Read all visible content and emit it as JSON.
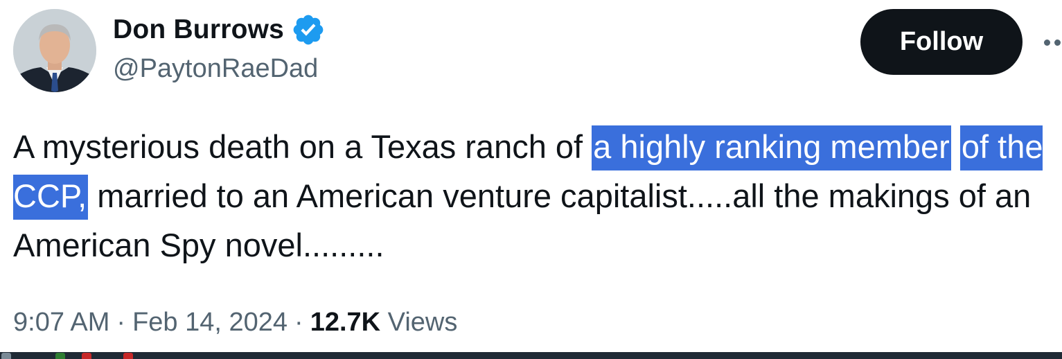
{
  "author": {
    "display_name": "Don Burrows",
    "handle": "@PaytonRaeDad",
    "verified": true,
    "verified_badge_color": "#1d9bf0",
    "avatar_icon": "profile-photo"
  },
  "actions": {
    "follow_label": "Follow",
    "more_icon": "more-horizontal-icon"
  },
  "tweet": {
    "text_before_highlight": "A mysterious death on a Texas ranch of ",
    "text_highlight_line1": "a highly ranking member",
    "text_highlight_line2": "of the CCP,",
    "text_after_highlight": " married to an American venture capitalist.....all the makings of an American Spy novel.........",
    "highlight_color": "#3a6fdc"
  },
  "meta": {
    "time": "9:07 AM",
    "separator": "·",
    "date": "Feb 14, 2024",
    "views_count": "12.7K",
    "views_label": "Views"
  },
  "colors": {
    "text_primary": "#0f1419",
    "text_secondary": "#536471",
    "follow_bg": "#0f1419",
    "follow_text": "#ffffff"
  }
}
